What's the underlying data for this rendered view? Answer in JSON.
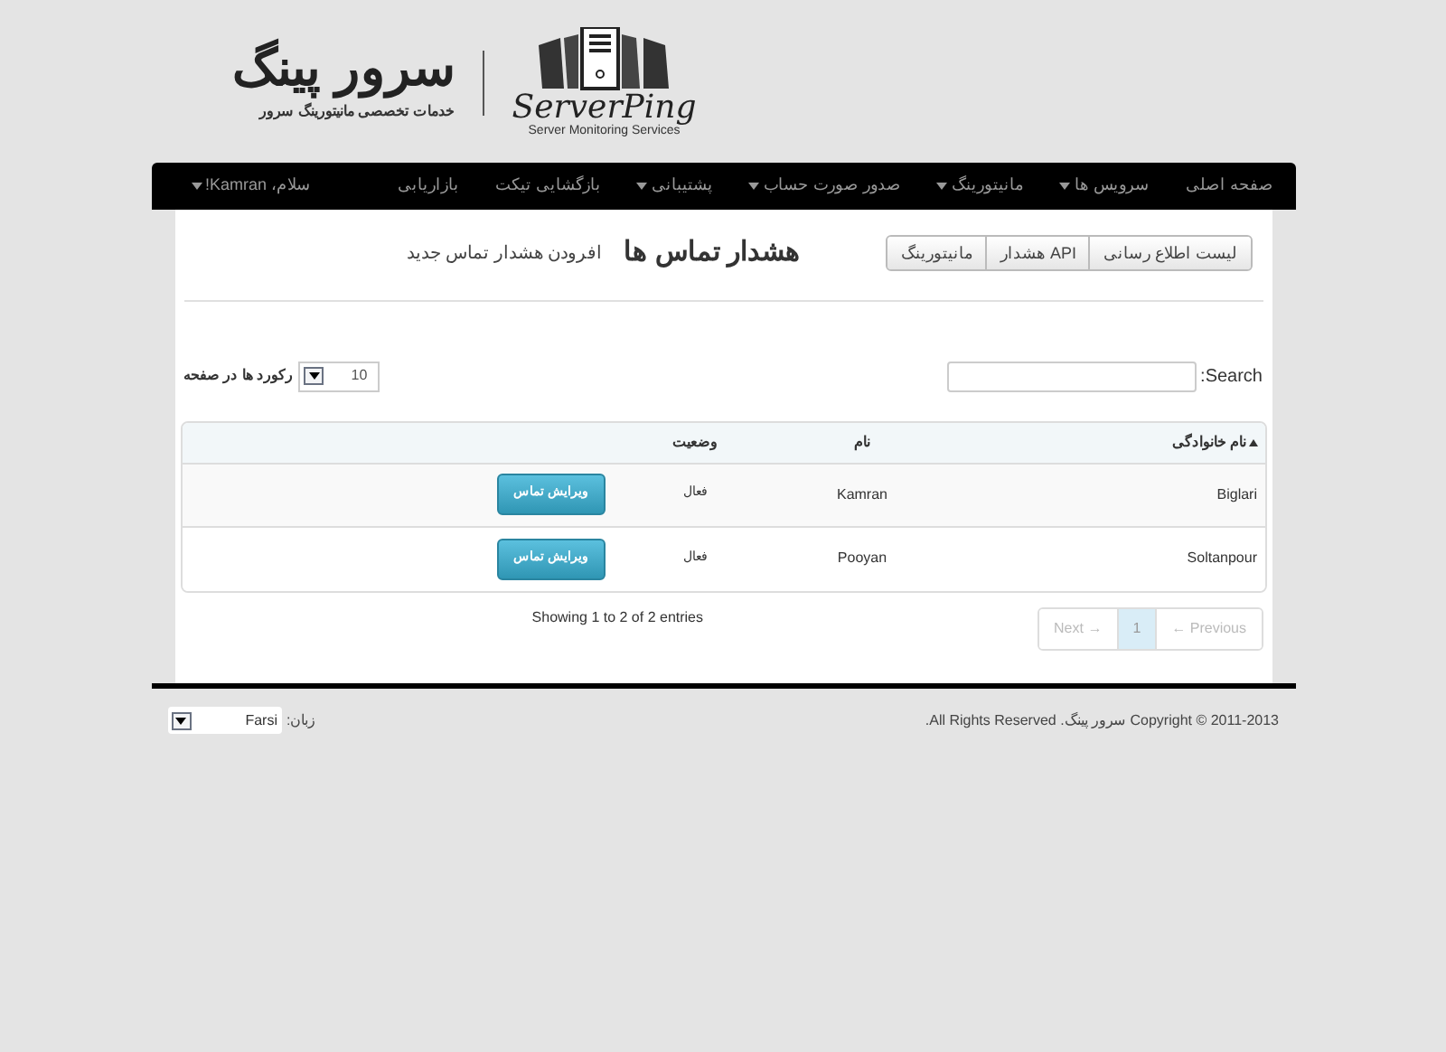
{
  "logo": {
    "title": "سرور پینگ",
    "tagline": "خدمات تخصصی مانیتورینگ سرور",
    "brand": "ServerPing",
    "brand_sub": "Server Monitoring Services"
  },
  "nav": {
    "items": [
      {
        "label": "صفحه اصلی",
        "dropdown": false
      },
      {
        "label": "سرویس ها",
        "dropdown": true
      },
      {
        "label": "مانیتورینگ",
        "dropdown": true
      },
      {
        "label": "صدور صورت حساب",
        "dropdown": true
      },
      {
        "label": "پشتیبانی",
        "dropdown": true
      },
      {
        "label": "بازگشایی تیکت",
        "dropdown": false
      },
      {
        "label": "بازاریابی",
        "dropdown": false
      }
    ],
    "user": {
      "label": "سلام، Kamran!",
      "dropdown": true
    }
  },
  "subnav": [
    "لیست اطلاع رسانی",
    "API هشدار",
    "مانیتورینگ"
  ],
  "page_title": "هشدار تماس ها",
  "add_link": "افرودن هشدار تماس جدید",
  "search": {
    "label": "Search:"
  },
  "page_size": {
    "value": "10",
    "label": "رکورد ها در صفحه"
  },
  "table": {
    "columns": [
      {
        "label": "نام خانوادگی",
        "sorted": true
      },
      {
        "label": "نام",
        "sorted": false
      },
      {
        "label": "وضعیت",
        "sorted": false
      }
    ],
    "rows": [
      {
        "last_name": "Biglari",
        "first_name": "Kamran",
        "status": "فعال",
        "action": "ویرایش تماس"
      },
      {
        "last_name": "Soltanpour",
        "first_name": "Pooyan",
        "status": "فعال",
        "action": "ویرایش تماس"
      }
    ]
  },
  "pagination": [
    {
      "label": "← Previous",
      "disabled": true,
      "selected": false
    },
    {
      "label": "1",
      "disabled": false,
      "selected": true
    },
    {
      "label": "Next →",
      "disabled": true,
      "selected": false
    }
  ],
  "info": "Showing 1 to 2 of 2 entries",
  "footer": {
    "copyright": "Copyright © 2011-2013 سرور پینگ. All Rights Reserved.",
    "language_label": "زبان:",
    "language": "Farsi"
  }
}
